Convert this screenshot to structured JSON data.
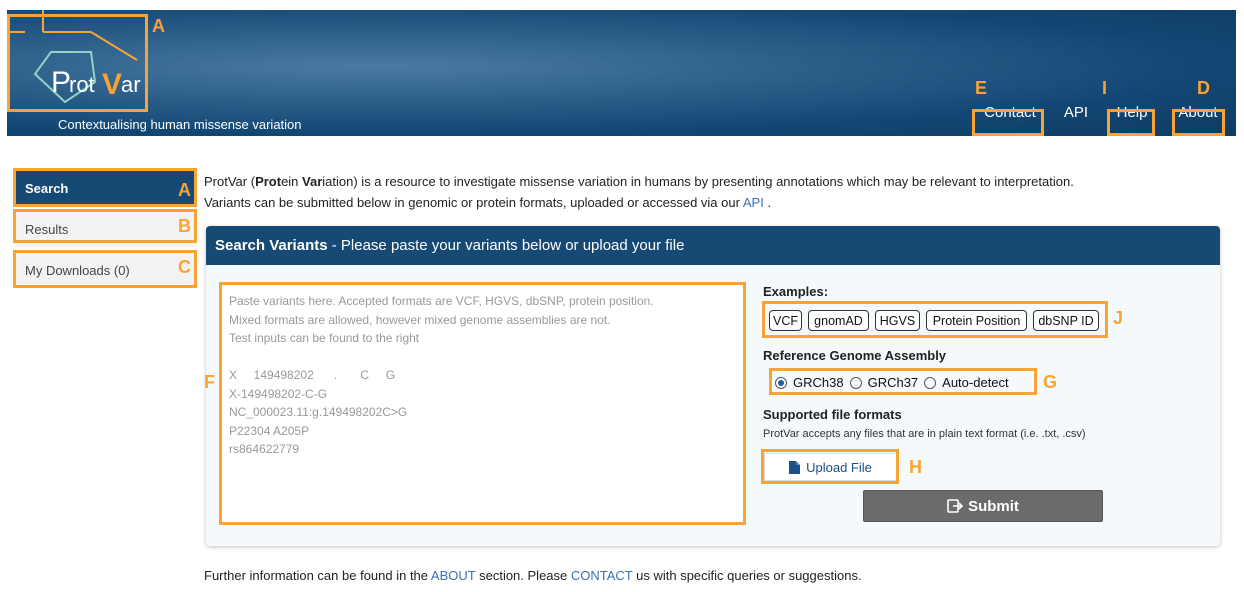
{
  "header": {
    "logo_text": "ProtVar",
    "tagline": "Contextualising human missense variation",
    "nav": {
      "contact": "Contact",
      "api": "API",
      "help": "Help",
      "about": "About"
    }
  },
  "sidebar": {
    "items": [
      {
        "label": "Search"
      },
      {
        "label": "Results"
      },
      {
        "label": "My Downloads (0)"
      }
    ]
  },
  "intro": {
    "pre": "ProtVar (",
    "b1": "Prot",
    "mid1": "ein ",
    "b2": "Var",
    "post": "iation) is a resource to investigate missense variation in humans by presenting annotations which may be relevant to interpretation.",
    "line2": "Variants can be submitted below in genomic or protein formats, uploaded or accessed via our",
    "line2_link": "API",
    "line2_end": " ."
  },
  "panel": {
    "title_bold": "Search Variants",
    "title_rest": " - Please paste your variants below or upload your file",
    "textarea_lines": [
      "Paste variants here. Accepted formats are VCF, HGVS, dbSNP, protein position.",
      "Mixed formats are allowed, however mixed genome assemblies are not.",
      "Test inputs can be found to the right",
      "",
      "X     149498202      .       C     G",
      "X-149498202-C-G",
      "NC_000023.11:g.149498202C>G",
      "P22304 A205P",
      "rs864622779"
    ],
    "examples_label": "Examples:",
    "examples": [
      "VCF",
      "gnomAD",
      "HGVS",
      "Protein Position",
      "dbSNP ID"
    ],
    "assembly_label": "Reference Genome Assembly",
    "assembly_options": [
      "GRCh38",
      "GRCh37",
      "Auto-detect"
    ],
    "assembly_selected": "GRCh38",
    "formats_label": "Supported file formats",
    "formats_desc": "ProtVar accepts any files that are in plain text format (i.e. .txt, .csv)",
    "upload_label": "Upload File",
    "submit_label": "Submit"
  },
  "footer": {
    "t1": "Further information can be found in the ",
    "about_link": "ABOUT",
    "t2": " section. Please ",
    "contact_link": "CONTACT",
    "t3": " us with specific queries or suggestions."
  },
  "annotations": {
    "logo": "A",
    "contact": "E",
    "help": "I",
    "about": "D",
    "search": "A",
    "results": "B",
    "downloads": "C",
    "textarea": "F",
    "examples": "J",
    "assembly": "G",
    "upload": "H"
  },
  "colors": {
    "annotation": "#f7a434",
    "header_dark": "#164a75",
    "link": "#3b6fb6",
    "submit": "#6b6b6b"
  }
}
